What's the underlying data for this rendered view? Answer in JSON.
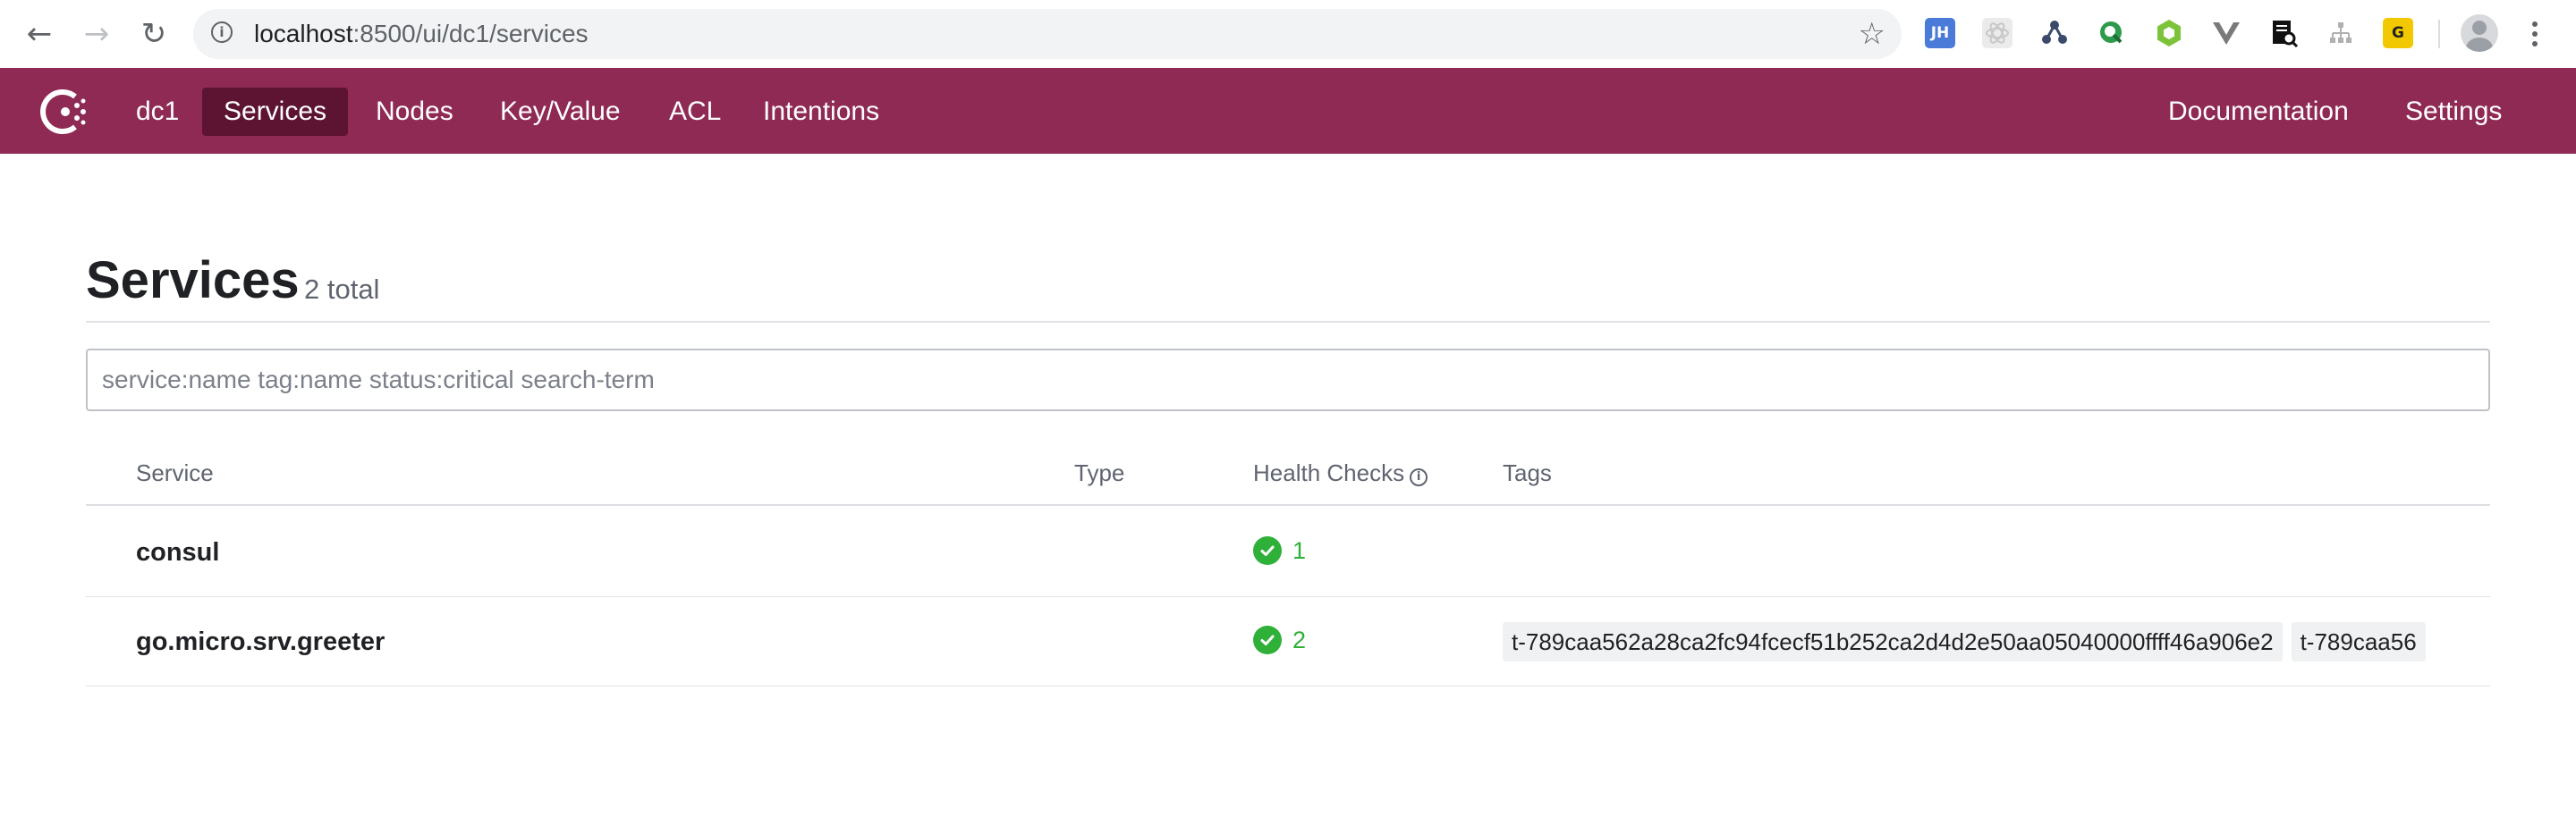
{
  "browser": {
    "url_host": "localhost",
    "url_rest": ":8500/ui/dc1/services",
    "extensions": [
      {
        "name": "jh-extension-icon",
        "label": "JH",
        "color": "#4a7bd9"
      },
      {
        "name": "react-devtools-icon",
        "label": "",
        "color": "#e6e6e6"
      },
      {
        "name": "graph-extension-icon",
        "label": "",
        "color": "#ffffff"
      },
      {
        "name": "search-extension-icon",
        "label": "",
        "color": "#2e9a4b"
      },
      {
        "name": "hexagon-extension-icon",
        "label": "",
        "color": "#7cc33a"
      },
      {
        "name": "vue-devtools-icon",
        "label": "",
        "color": "#ffffff"
      },
      {
        "name": "page-search-icon",
        "label": "",
        "color": "#ffffff"
      },
      {
        "name": "sitemap-icon",
        "label": "",
        "color": "#ffffff"
      },
      {
        "name": "grammarly-icon",
        "label": "G",
        "color": "#f2c900"
      }
    ]
  },
  "header": {
    "datacenter": "dc1",
    "nav": [
      "Services",
      "Nodes",
      "Key/Value",
      "ACL",
      "Intentions"
    ],
    "right_nav": [
      "Documentation",
      "Settings"
    ]
  },
  "page": {
    "title": "Services",
    "total": "2 total",
    "search_placeholder": "service:name tag:name status:critical search-term"
  },
  "table": {
    "columns": [
      "Service",
      "Type",
      "Health Checks",
      "Tags"
    ],
    "rows": [
      {
        "service": "consul",
        "type": "",
        "health_passing": "1",
        "tags": []
      },
      {
        "service": "go.micro.srv.greeter",
        "type": "",
        "health_passing": "2",
        "tags": [
          "t-789caa562a28ca2fc94fcecf51b252ca2d4d2e50aa05040000ffff46a906e2",
          "t-789caa56"
        ]
      }
    ]
  },
  "colors": {
    "brand": "#8e2a54",
    "brand_active": "#5d1332",
    "passing": "#2eb039"
  }
}
